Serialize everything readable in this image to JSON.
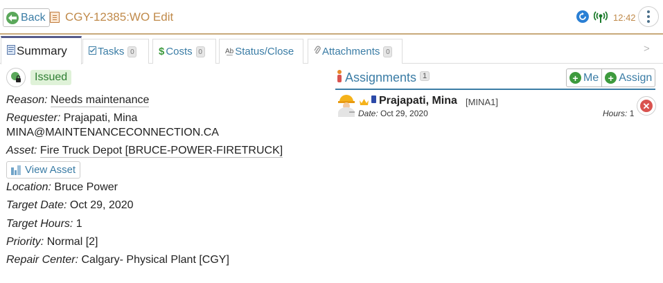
{
  "header": {
    "back_label": "Back",
    "title": "CGY-12385:WO Edit",
    "time": "12:42"
  },
  "tabs": [
    {
      "label": "Summary",
      "badge": ""
    },
    {
      "label": "Tasks",
      "badge": "0"
    },
    {
      "label": "Costs",
      "badge": "0"
    },
    {
      "label": "Status/Close",
      "badge": ""
    },
    {
      "label": "Attachments",
      "badge": "0"
    }
  ],
  "summary": {
    "status": "Issued",
    "reason_label": "Reason:",
    "reason": "Needs maintenance",
    "requester_label": "Requester:",
    "requester": "Prajapati, Mina",
    "requester_email": "MINA@MAINTENANCECONNECTION.CA",
    "asset_label": "Asset:",
    "asset": "Fire Truck Depot [BRUCE-POWER-FIRETRUCK]",
    "view_asset_label": "View Asset",
    "location_label": "Location:",
    "location": "Bruce Power",
    "target_date_label": "Target Date:",
    "target_date": "Oct 29, 2020",
    "target_hours_label": "Target Hours:",
    "target_hours": "1",
    "priority_label": "Priority:",
    "priority": "Normal [2]",
    "repair_center_label": "Repair Center:",
    "repair_center": "Calgary- Physical Plant [CGY]"
  },
  "assignments": {
    "title": "Assignments",
    "count": "1",
    "me_label": "Me",
    "assign_label": "Assign",
    "items": [
      {
        "name": "Prajapati, Mina",
        "code": "[MINA1]",
        "date_label": "Date:",
        "date": "Oct 29, 2020",
        "hours_label": "Hours:",
        "hours": "1"
      }
    ]
  },
  "colors": {
    "accent": "#3a7ca5",
    "title": "#c08a4a",
    "status_bg": "#dff2d8",
    "status_text": "#2e7d32",
    "danger": "#d9534f"
  },
  "icons": {
    "back": "back-arrow-icon",
    "sync": "sync-icon",
    "signal": "signal-icon",
    "more": "more-vertical-icon"
  }
}
